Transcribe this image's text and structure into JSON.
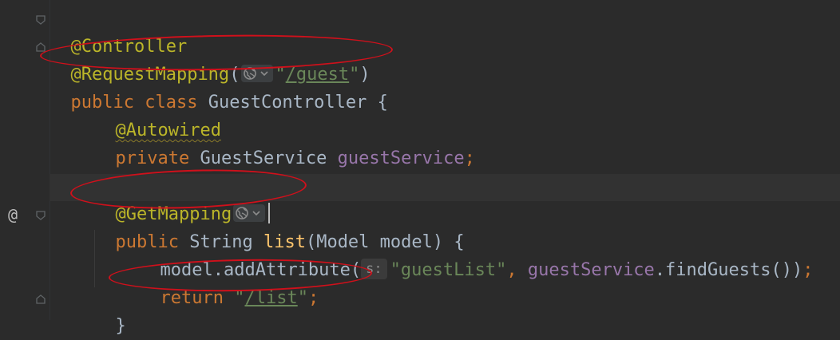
{
  "editor": {
    "lines": {
      "l1": {
        "annotation": "@Controller"
      },
      "l2": {
        "annotation": "@RequestMapping",
        "open": "(",
        "quote_open": "\"",
        "path": "/guest",
        "quote_close": "\"",
        "close": ")"
      },
      "l3": {
        "kw1": "public",
        "kw2": "class",
        "name": "GuestController",
        "brace": "{"
      },
      "l4": {
        "annotation": "@Autowired"
      },
      "l5": {
        "kw": "private",
        "type": "GuestService",
        "field": "guestService",
        "semi": ";"
      },
      "l7": {
        "annotation": "@GetMapping"
      },
      "l8": {
        "kw": "public",
        "type": "String",
        "method": "list",
        "params": "(Model model)",
        "brace": "{"
      },
      "l9": {
        "receiver": "model.addAttribute(",
        "hint": "s:",
        "arg": "\"guestList\"",
        "comma": ",",
        "field": "guestService",
        "call": ".findGuests())",
        "semi": ";"
      },
      "l10": {
        "kw": "return",
        "quote_open": "\"",
        "path": "/list",
        "quote_close": "\"",
        "semi": ";"
      },
      "l11": {
        "brace": "}"
      }
    },
    "gutter": {
      "marker": "@"
    },
    "icons": {
      "globe": "globe-icon",
      "chevron": "chevron-down-icon",
      "fold": "fold-arrow-icon"
    },
    "colors": {
      "background": "#2b2b2b",
      "annotation": "#bbb529",
      "keyword": "#cc7832",
      "string": "#6a8759",
      "field": "#9876aa",
      "method": "#ffc66d",
      "text": "#a9b7c6",
      "highlight_ellipse": "#d0101b"
    }
  }
}
